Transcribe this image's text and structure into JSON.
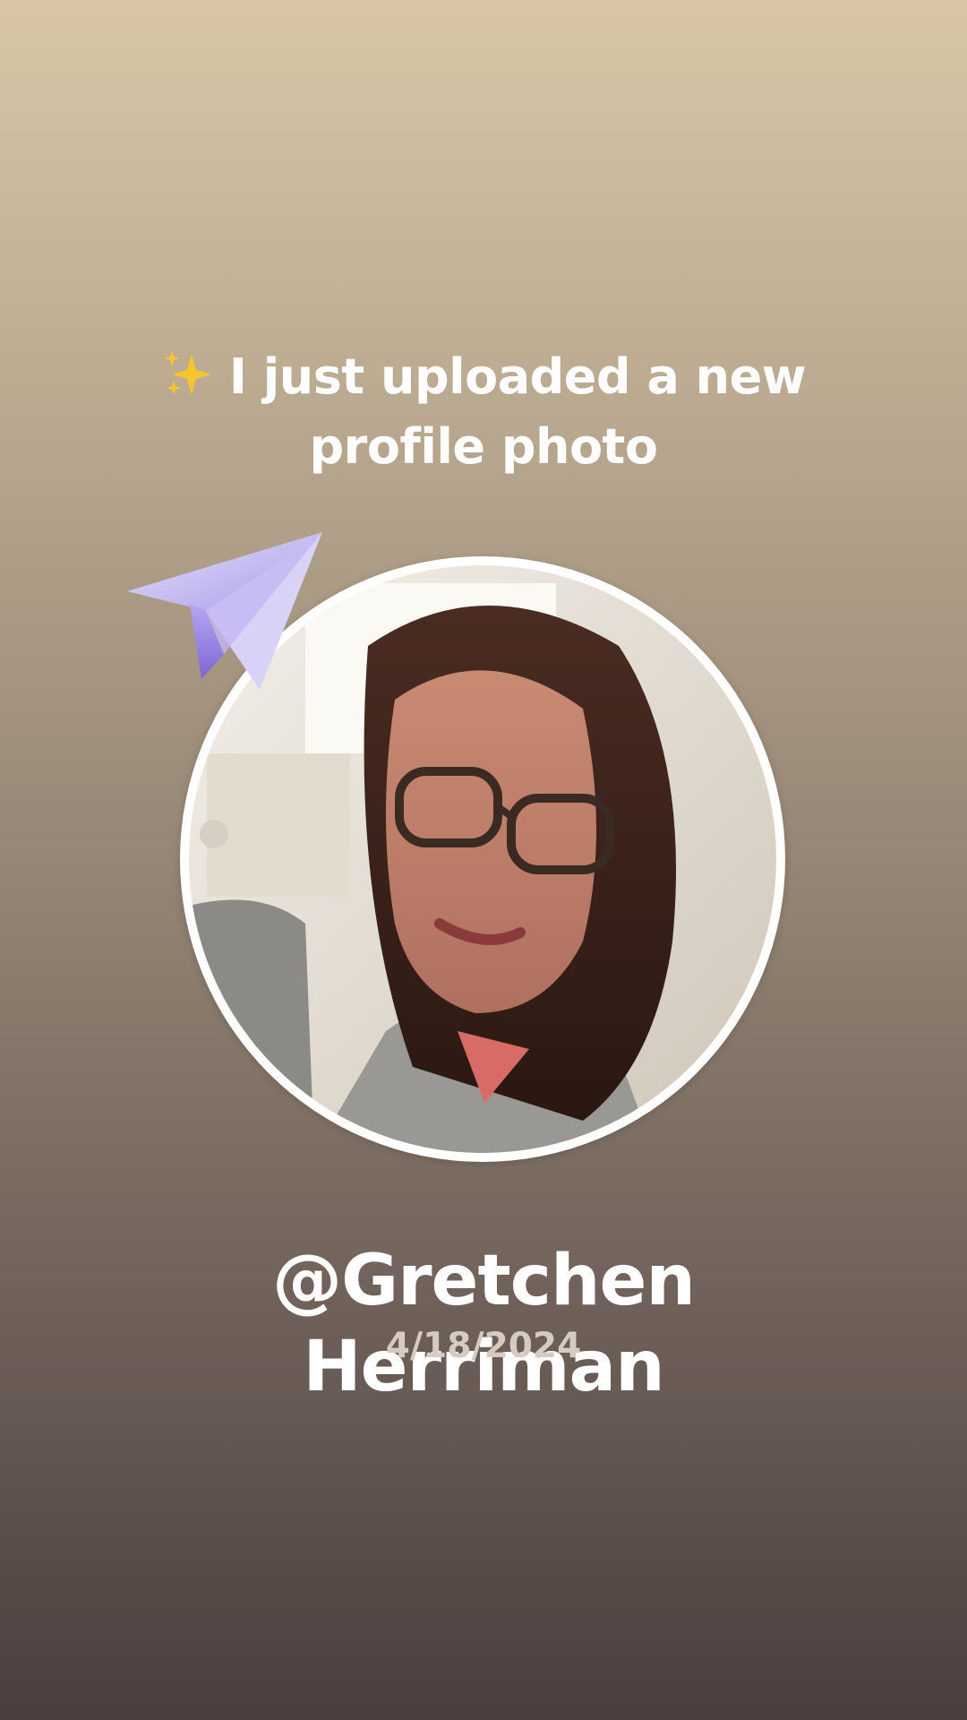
{
  "post": {
    "headline": "I just uploaded a new profile photo",
    "username": "@Gretchen Herriman",
    "date": "4/18/2024"
  },
  "icons": {
    "headline_emoji": "sparkles-icon",
    "decoration": "paper-plane-icon"
  },
  "colors": {
    "background_top": "#d8c6a6",
    "background_bottom": "#4b3e3d",
    "text": "#ffffff",
    "date_text": "#d6cbc3",
    "photo_border": "#ffffff",
    "plane": "#a79be6"
  }
}
